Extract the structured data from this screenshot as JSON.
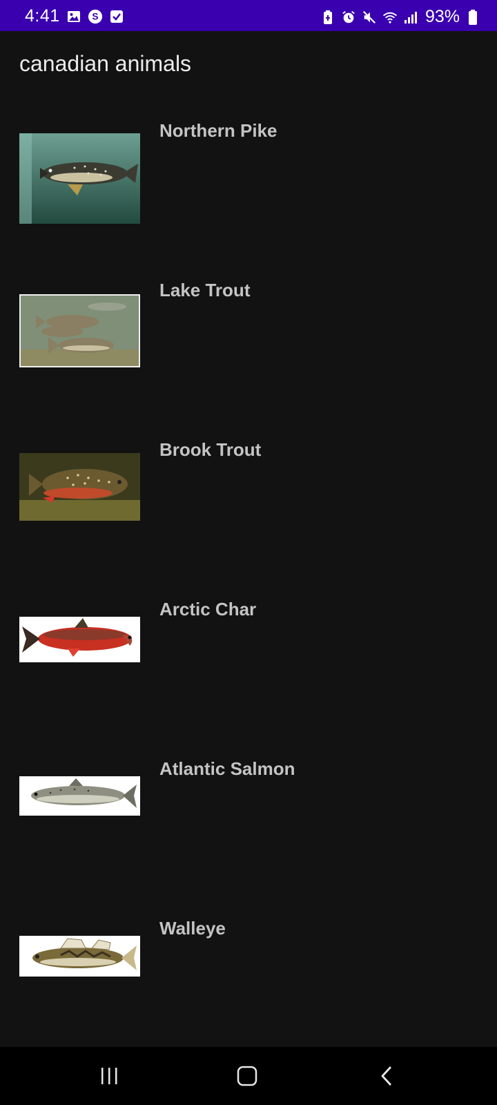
{
  "status_bar": {
    "time": "4:41",
    "battery_percent": "93%",
    "background": "#3a00b0"
  },
  "app": {
    "title": "canadian animals"
  },
  "animals": [
    {
      "name": "Northern Pike",
      "thumbnail_icon": "northern-pike-photo"
    },
    {
      "name": "Lake Trout",
      "thumbnail_icon": "lake-trout-photo"
    },
    {
      "name": "Brook Trout",
      "thumbnail_icon": "brook-trout-photo"
    },
    {
      "name": "Arctic Char",
      "thumbnail_icon": "arctic-char-photo"
    },
    {
      "name": "Atlantic Salmon",
      "thumbnail_icon": "atlantic-salmon-photo"
    },
    {
      "name": "Walleye",
      "thumbnail_icon": "walleye-photo"
    }
  ],
  "nav_bar": {
    "recents_icon": "recents-icon",
    "home_icon": "home-icon",
    "back_icon": "back-icon"
  }
}
